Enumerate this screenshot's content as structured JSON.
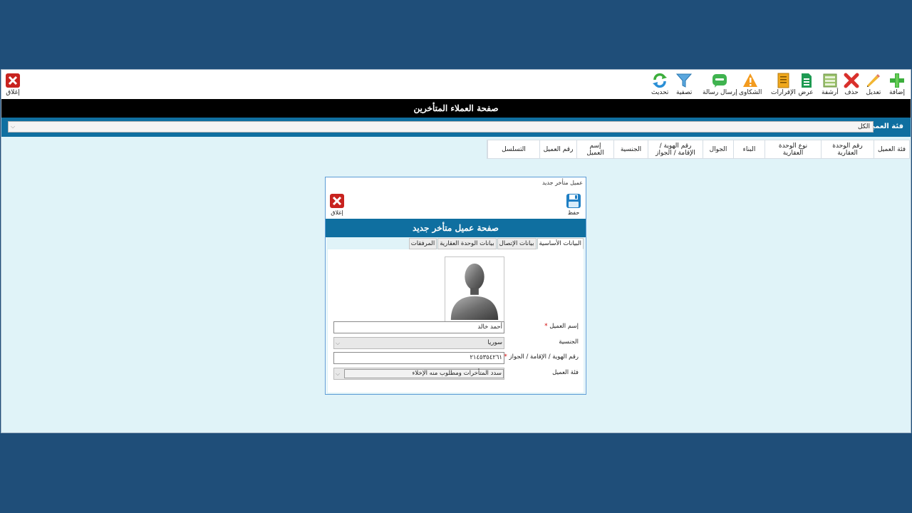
{
  "toolbar": {
    "add": "إضافة",
    "edit": "تعديل",
    "delete": "حذف",
    "archive": "أرشفة",
    "view": "عرض",
    "reports": "الإقرارات",
    "complaints": "الشكاوى",
    "send_message": "إرسال رسالة",
    "filter": "تصفية",
    "refresh": "تحديث",
    "close": "إغلاق"
  },
  "page_title": "صفحة العملاء المتأخرين",
  "client_category_filter": {
    "label": "فئة العميل",
    "value": "الكل"
  },
  "grid": {
    "columns": [
      "التسلسل",
      "رقم العميل",
      "إسم العميل",
      "الجنسية",
      "رقم الهوية / الإقامة / الجواز",
      "الجوال",
      "البناء",
      "نوع الوحدة العقارية",
      "رقم الوحدة العقارية",
      "فئة العميل"
    ]
  },
  "dialog": {
    "caption": "عميل متأخر جديد",
    "save": "حفظ",
    "close": "إغلاق",
    "title": "صفحة عميل متأخر جديد",
    "tabs": [
      "البيانات الأساسية",
      "بيانات الإتصال",
      "بيانات الوحدة العقارية",
      "المرفقات"
    ],
    "form": {
      "client_name_label": "إسم العميل",
      "client_name_value": "أحمد خالد",
      "nationality_label": "الجنسية",
      "nationality_value": "سوريا",
      "id_label": "رقم الهوية / الإقامة / الجواز",
      "id_value": "٢١٤٥٣٥٤٢٦١",
      "category_label": "فئة العميل",
      "category_value": "سدد المتأخرات ومطلوب منه الإخلاء",
      "required_mark": "*"
    }
  },
  "colors": {
    "desktop": "#1f4e79",
    "header_blue": "#0f6fa0",
    "content_bg": "#e0f3f8"
  }
}
